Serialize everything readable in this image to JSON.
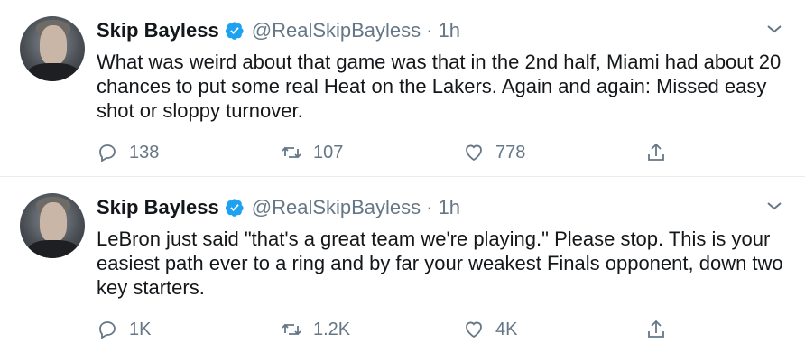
{
  "tweets": [
    {
      "author_name": "Skip Bayless",
      "handle": "@RealSkipBayless",
      "separator": "·",
      "time": "1h",
      "text": "What was weird about that game was that in the 2nd half, Miami had about 20 chances to put some real Heat on the Lakers. Again and again: Missed easy shot or sloppy turnover.",
      "replies": "138",
      "retweets": "107",
      "likes": "778"
    },
    {
      "author_name": "Skip Bayless",
      "handle": "@RealSkipBayless",
      "separator": "·",
      "time": "1h",
      "text": "LeBron just said \"that's a great team we're playing.\" Please stop. This is your easiest path ever to a ring and by far your weakest Finals opponent, down two key starters.",
      "replies": "1K",
      "retweets": "1.2K",
      "likes": "4K"
    }
  ],
  "icons": {
    "verified": "verified-badge-icon",
    "caret": "chevron-down-icon",
    "reply": "reply-icon",
    "retweet": "retweet-icon",
    "like": "heart-icon",
    "share": "share-icon"
  },
  "colors": {
    "accent": "#1da1f2",
    "secondary_text": "#657786",
    "primary_text": "#14171a",
    "divider": "#e6ecf0"
  }
}
